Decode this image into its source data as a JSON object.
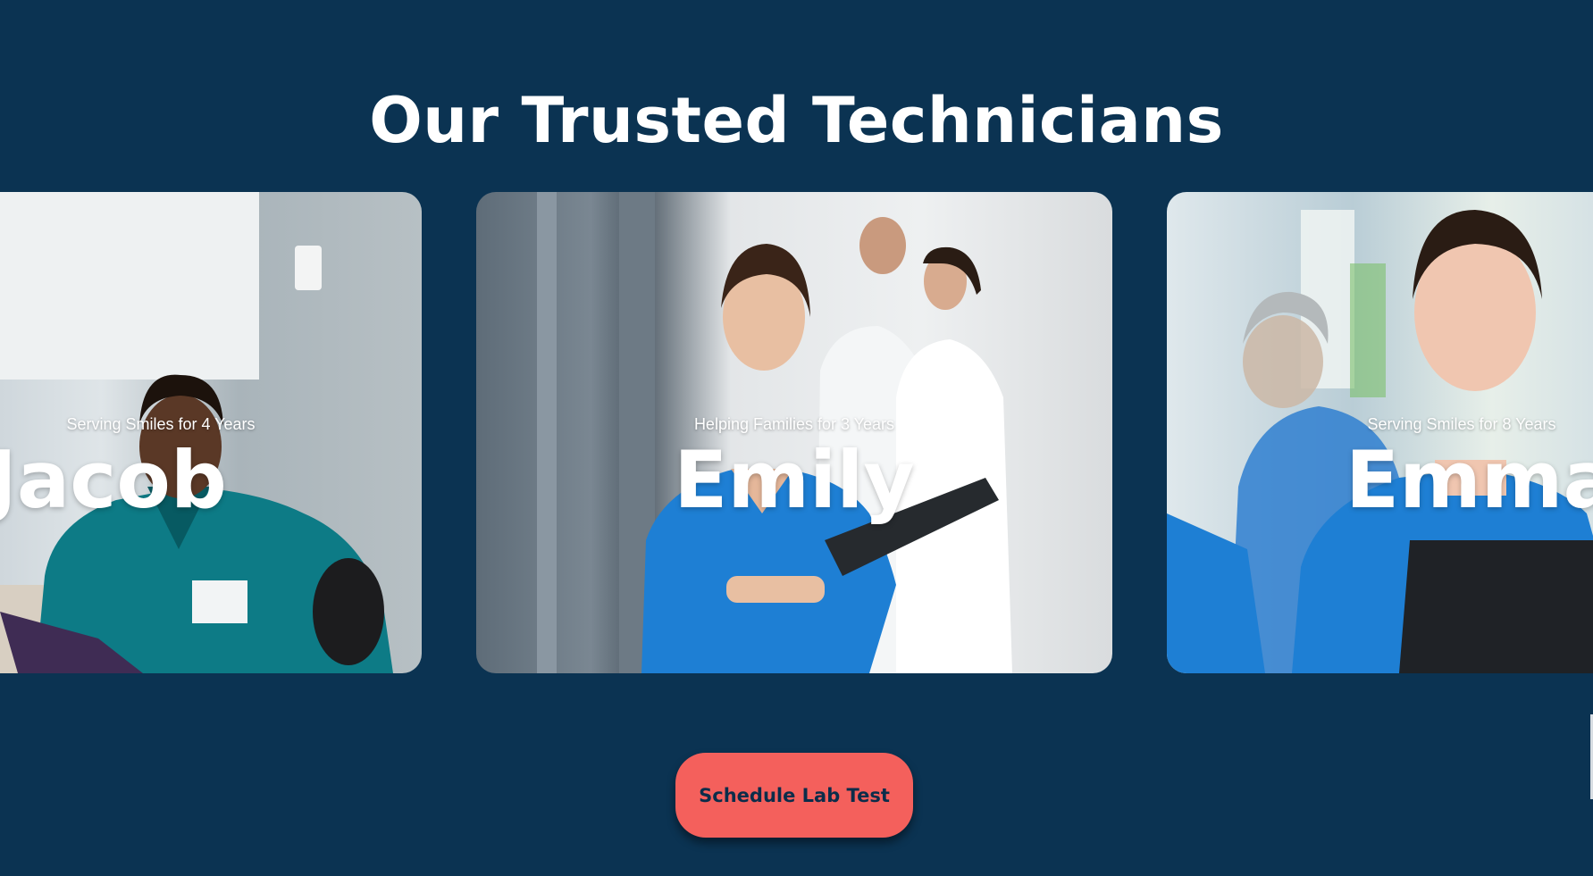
{
  "section": {
    "title": "Our Trusted Technicians"
  },
  "technicians": [
    {
      "subtitle": "Serving Smiles for 4 Years",
      "name": "Jacob"
    },
    {
      "subtitle": "Helping Families for 3 Years",
      "name": "Emily"
    },
    {
      "subtitle": "Serving Smiles for 8 Years",
      "name": "Emma"
    }
  ],
  "cta": {
    "label": "Schedule Lab Test"
  },
  "colors": {
    "background": "#0b3352",
    "button": "#f4605c",
    "button_text": "#0b2d4a",
    "scrub_teal": "#0d7b86",
    "scrub_blue": "#1e7fd4"
  }
}
